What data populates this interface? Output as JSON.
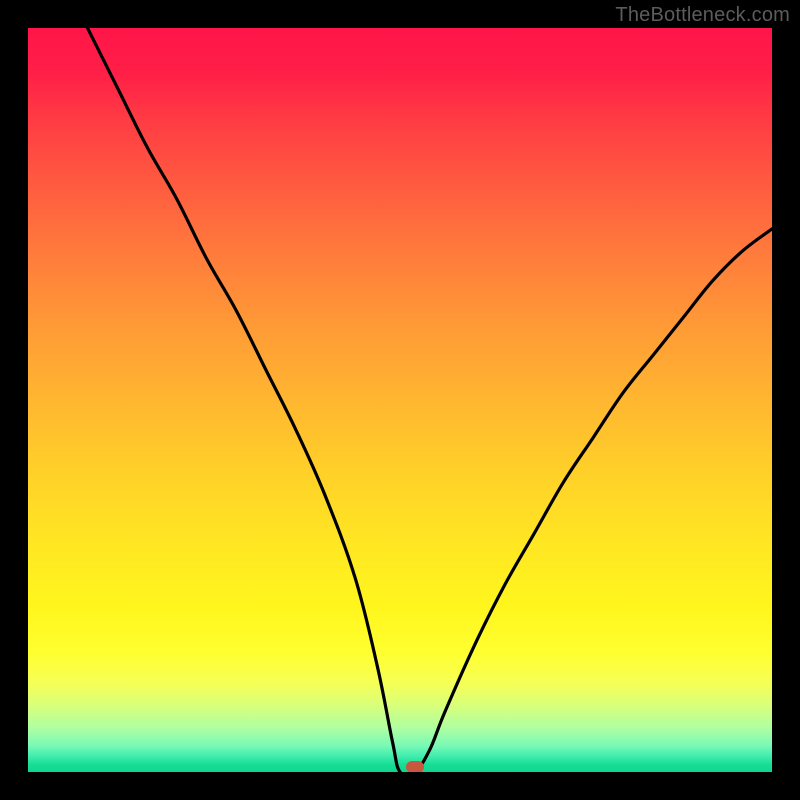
{
  "watermark": "TheBottleneck.com",
  "marker": {
    "x_pct": 52,
    "y_pct": 99.3
  },
  "chart_data": {
    "type": "line",
    "title": "",
    "xlabel": "",
    "ylabel": "",
    "xlim": [
      0,
      100
    ],
    "ylim": [
      0,
      100
    ],
    "grid": false,
    "series": [
      {
        "name": "bottleneck-curve",
        "x": [
          8,
          12,
          16,
          20,
          24,
          28,
          32,
          36,
          40,
          44,
          47,
          49,
          50,
          52,
          54,
          56,
          60,
          64,
          68,
          72,
          76,
          80,
          84,
          88,
          92,
          96,
          100
        ],
        "y": [
          100,
          92,
          84,
          77,
          69,
          62,
          54,
          46,
          37,
          26,
          14,
          4,
          0,
          0,
          3,
          8,
          17,
          25,
          32,
          39,
          45,
          51,
          56,
          61,
          66,
          70,
          73
        ]
      }
    ],
    "annotations": [
      {
        "type": "marker",
        "x": 52,
        "y": 0.7,
        "label": "optimal-point"
      }
    ]
  }
}
